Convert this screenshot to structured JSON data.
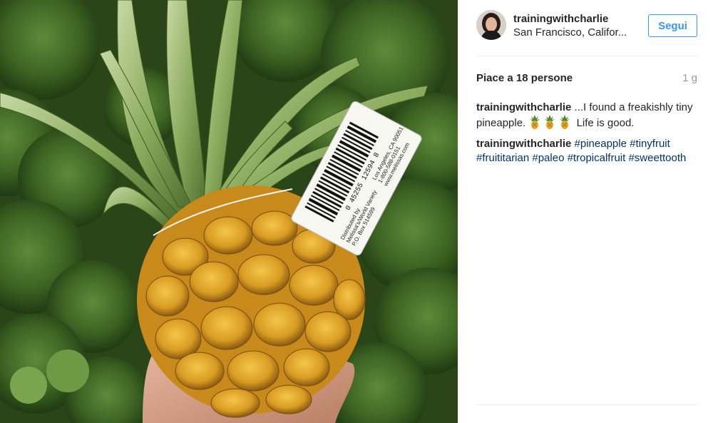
{
  "post": {
    "username": "trainingwithcharlie",
    "location": "San Francisco, Califor...",
    "follow_label": "Segui",
    "likes_text": "Piace a 18 persone",
    "time_ago": "1 g"
  },
  "caption": {
    "user": "trainingwithcharlie",
    "text_before": " ...I found a freakishly tiny pineapple. ",
    "emoji_name": "pineapple-emoji",
    "text_after": " Life is good."
  },
  "hashtag_comment": {
    "user": "trainingwithcharlie",
    "tags": [
      "#pineapple",
      "#tinyfruit",
      "#fruititarian",
      "#paleo",
      "#tropicalfruit",
      "#sweettooth"
    ]
  },
  "photo_label": {
    "barcode_number": "0 45255 12594 8",
    "line1": "Distributed by",
    "line2": "Melissa's/World Variety",
    "line3": "P.O. Box 514599",
    "line4": "Los Angeles, CA 90051",
    "line5": "1-800-588-0151",
    "line6": "www.melissas.com"
  },
  "colors": {
    "follow_blue": "#3897f0",
    "hashtag_blue": "#003569",
    "text_dark": "#262626",
    "muted": "#999999"
  }
}
